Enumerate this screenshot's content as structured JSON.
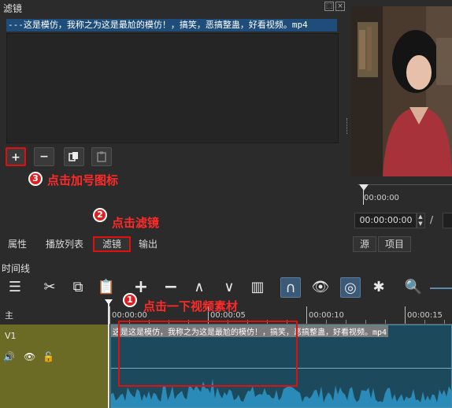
{
  "filters_panel": {
    "title": "滤镜",
    "file_name": "---这是模仿，我称之为这是最尬的模仿！，搞笑，恶搞整蛊，好看视频。mp4",
    "buttons": {
      "add": "+",
      "remove": "−",
      "copy": "⎘",
      "paste": "📋"
    },
    "window_controls": [
      "⬚",
      "×"
    ]
  },
  "annotations": {
    "step1": {
      "num": "1",
      "text": "点击一下视频素材"
    },
    "step2": {
      "num": "2",
      "text": "点击滤镜"
    },
    "step3": {
      "num": "3",
      "text": "点击加号图标"
    }
  },
  "tabs": {
    "properties": "属性",
    "playlist": "播放列表",
    "filters": "滤镜",
    "export": "输出"
  },
  "player": {
    "ruler_label": "00:00:00",
    "timecode": "00:00:00:00",
    "separator": "/",
    "tabs": {
      "source": "源",
      "project": "项目"
    }
  },
  "timeline": {
    "title": "时间线",
    "master_label": "主",
    "track_label": "V1",
    "ruler_labels": [
      "00:00:00",
      "00:00:05",
      "00:00:10",
      "00:00:15"
    ],
    "clip_name": "这是这是模仿，我称之为这是最尬的模仿！，搞笑，恶搞整蛊，好看视频。mp4",
    "toolbar_icons": [
      "menu-icon",
      "cut-icon",
      "copy-icon",
      "paste-icon",
      "append-icon",
      "remove-icon",
      "lift-icon",
      "overwrite-icon",
      "split-icon",
      "snap-icon",
      "scrub-icon",
      "ripple-icon",
      "ripple-all-icon",
      "zoom-out-icon"
    ]
  },
  "colors": {
    "accent_red": "#e01010",
    "banner_blue": "#1e4d7a",
    "clip_teal": "#1c4a5c",
    "track_olive": "#6b6b26"
  }
}
